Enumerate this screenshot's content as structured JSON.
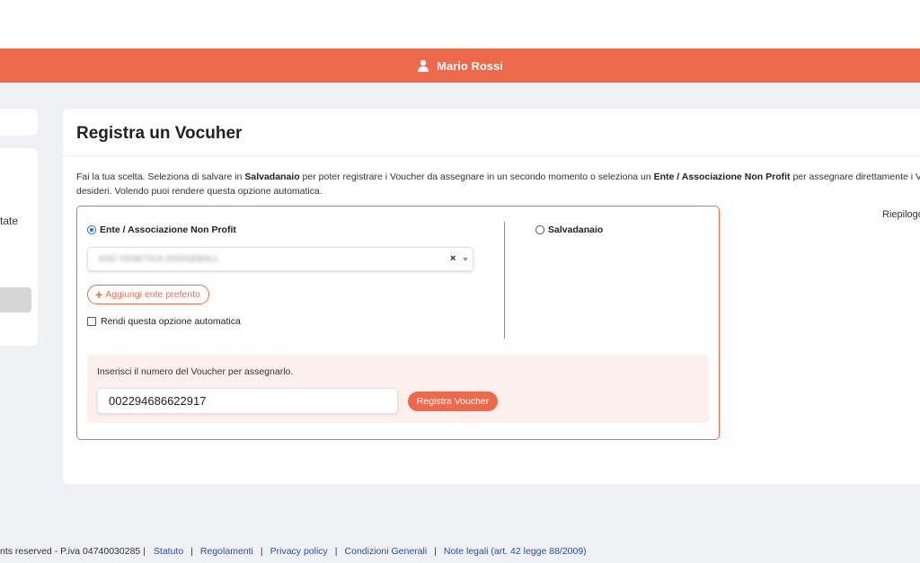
{
  "header": {
    "user_name": "Mario Rossi",
    "icon": "user-icon",
    "bg_color": "#ec6a4b"
  },
  "sidebar": {
    "fragment_text": "tate"
  },
  "main": {
    "title": "Registra un Vocuher",
    "description": {
      "p1": "Fai la tua scelta. Seleziona di salvare in ",
      "b1": "Salvadanaio",
      "p2": " per poter registrare i Voucher da assegnare in un secondo momento o seleziona un ",
      "b2": "Ente / Associazione Non Profit",
      "p3": " per assegnare direttamente i Vou",
      "line2": "desideri. Volendo puoi rendere questa opzione automatica."
    },
    "riepilogo": "Riepilogo",
    "options": {
      "ente_label": "Ente / Associazione Non Profit",
      "salvadanaio_label": "Salvadanaio",
      "selected": "ente"
    },
    "select": {
      "value": "ASD VENETICA DODGEBALL",
      "clear_symbol": "×"
    },
    "add_button": {
      "plus": "+",
      "label": "Aggiungi ente preferito"
    },
    "checkbox": {
      "label": "Rendi questa opzione automatica",
      "checked": false
    },
    "voucher": {
      "label": "Inserisci il numero del Voucher per assegnarlo.",
      "value": "002294686622917",
      "button_label": "Registra Voucher"
    }
  },
  "footer": {
    "prefix": "nts reserved - P.iva 04740030285 |",
    "separator": "|",
    "links": [
      "Statuto",
      "Regolamenti",
      "Privacy policy",
      "Condizioni Generali",
      "Note legali (art. 42 legge 88/2009)"
    ]
  }
}
